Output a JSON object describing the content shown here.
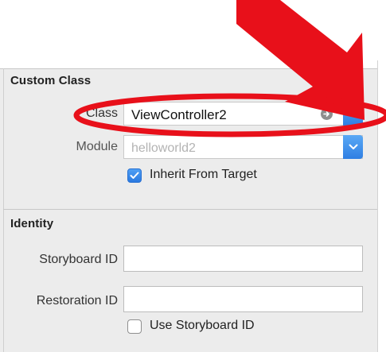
{
  "custom_class": {
    "title": "Custom Class",
    "class_label": "Class",
    "class_value": "ViewController2",
    "module_label": "Module",
    "module_placeholder": "helloworld2",
    "inherit_label": "Inherit From Target",
    "inherit_checked": true
  },
  "identity": {
    "title": "Identity",
    "storyboard_id_label": "Storyboard ID",
    "storyboard_id_value": "",
    "restoration_id_label": "Restoration ID",
    "restoration_id_value": "",
    "use_storyboard_id_label": "Use Storyboard ID",
    "use_storyboard_id_checked": false
  },
  "icons": {
    "goto": "arrow-circle-icon",
    "dropdown": "chevron-down-icon",
    "checkmark": "checkmark-icon"
  },
  "colors": {
    "panel_bg": "#ececec",
    "accent_blue": "#2f7fe3",
    "annotation_red": "#e8101a"
  }
}
